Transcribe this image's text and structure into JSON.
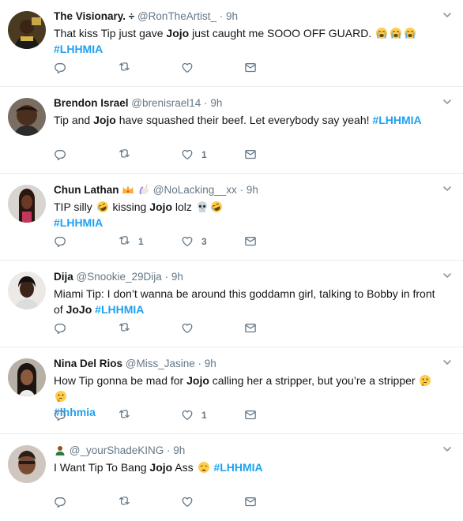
{
  "tweets": [
    {
      "name": "The Visionary. ÷",
      "handle": "@RonTheArtist_",
      "time": "9h",
      "text": [
        {
          "t": "That kiss Tip just gave "
        },
        {
          "b": "Jojo"
        },
        {
          "t": " just caught me SOOO OFF GUARD. "
        },
        {
          "e": "crying-face"
        },
        {
          "e": "crying-face"
        },
        {
          "e": "crying-face"
        },
        {
          "br": true
        },
        {
          "h": "#LHHMIA"
        }
      ],
      "retweets": "",
      "likes": ""
    },
    {
      "name": "Brendon Israel",
      "handle": "@brenisrael14",
      "time": "9h",
      "text": [
        {
          "t": "Tip and "
        },
        {
          "b": "Jojo"
        },
        {
          "t": " have squashed their beef. Let everybody say yeah! "
        },
        {
          "h": "#LHHMIA"
        }
      ],
      "retweets": "",
      "likes": "1"
    },
    {
      "name": "Chun Lathan",
      "name_badges": [
        "crown",
        "unicorn"
      ],
      "handle": "@NoLacking__xx",
      "time": "9h",
      "text": [
        {
          "t": "TIP silly "
        },
        {
          "e": "rofl-face"
        },
        {
          "t": " kissing "
        },
        {
          "b": "Jojo"
        },
        {
          "t": " lolz "
        },
        {
          "e": "skull"
        },
        {
          "e": "rofl-face"
        },
        {
          "br": true
        },
        {
          "h": "#LHHMIA"
        }
      ],
      "retweets": "1",
      "likes": "3"
    },
    {
      "name": "Dija",
      "handle": "@Snookie_29Dija",
      "time": "9h",
      "text": [
        {
          "t": "Miami Tip: I don’t wanna be around this goddamn girl, talking to Bobby in front"
        },
        {
          "br": true
        },
        {
          "t": "of "
        },
        {
          "b": "JoJo"
        },
        {
          "t": " "
        },
        {
          "h": "#LHHMIA"
        }
      ],
      "retweets": "",
      "likes": ""
    },
    {
      "name": "Nina Del Rios",
      "handle": "@Miss_Jasine",
      "time": "9h",
      "text": [
        {
          "t": "How Tip gonna be mad for "
        },
        {
          "b": "Jojo"
        },
        {
          "t": " calling her a stripper, but you’re a stripper "
        },
        {
          "e": "thinking-face"
        },
        {
          "e": "thinking-face"
        },
        {
          "br": true
        },
        {
          "h": "#lhhmia"
        }
      ],
      "retweets": "",
      "likes": "1"
    },
    {
      "name": "",
      "name_badges": [
        "person-emoji"
      ],
      "handle": "@_yourShadeKING",
      "time": "9h",
      "text": [
        {
          "t": "I Want Tip To Bang "
        },
        {
          "b": "Jojo"
        },
        {
          "t": " Ass "
        },
        {
          "e": "weary-face"
        },
        {
          "t": " "
        },
        {
          "h": "#LHHMIA"
        }
      ],
      "retweets": "",
      "likes": ""
    }
  ],
  "colors": {
    "accent": "#1da1f2",
    "muted": "#657786",
    "text": "#14171a",
    "divider": "#e6ecf0"
  },
  "icons": [
    "reply-icon",
    "retweet-icon",
    "like-icon",
    "direct-message-icon",
    "chevron-down-icon"
  ]
}
